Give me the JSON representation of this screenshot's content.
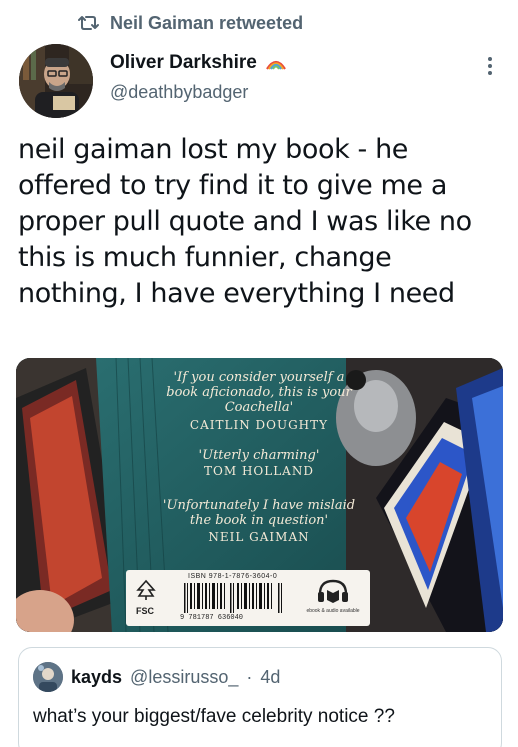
{
  "retweet": {
    "icon": "retweet-icon",
    "text": "Neil Gaiman retweeted"
  },
  "tweet": {
    "author": {
      "display_name": "Oliver Darkshire",
      "badge_icon": "rainbow-badge-icon",
      "handle": "@deathbybadger"
    },
    "text": "neil gaiman lost my book - he offered to try find it to give me a proper pull quote and I was like no this is much funnier, change nothing, I have everything I need",
    "media": {
      "quotes": [
        {
          "quote": "'If you consider yourself a book aficionado, this is your Coachella'",
          "author": "CAITLIN DOUGHTY"
        },
        {
          "quote": "'Utterly charming'",
          "author": "TOM HOLLAND"
        },
        {
          "quote": "'Unfortunately I have mislaid the book in question'",
          "author": "NEIL GAIMAN"
        }
      ],
      "isbn": "ISBN 978-1-7876-3604-0",
      "barcode_digits": "9 781787 636040",
      "fsc": "FSC",
      "ebook": "ebook & audio available"
    }
  },
  "quoted_tweet": {
    "display_name": "kayds",
    "handle": "@lessirusso_",
    "separator": "·",
    "time": "4d",
    "text": "what’s your biggest/fave celebrity notice ??"
  },
  "colors": {
    "secondary_text": "#536471",
    "primary_text": "#0f1419",
    "book_teal": "#1e5a5c",
    "border": "#cfd9de"
  }
}
